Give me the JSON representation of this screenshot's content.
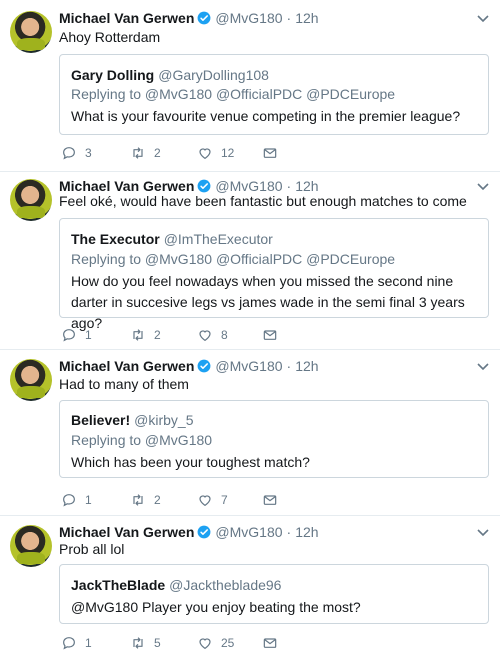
{
  "tweets": [
    {
      "author": "Michael Van Gerwen",
      "handle": "@MvG180",
      "dot": "·",
      "time": "12h",
      "text": "Ahoy Rotterdam",
      "quote": {
        "name": "Gary Dolling",
        "handle": "@GaryDolling108",
        "replying": "Replying to @MvG180 @OfficialPDC @PDCEurope",
        "text": "What is your favourite venue competing in the premier league?"
      },
      "replies": "3",
      "retweets": "2",
      "likes": "12"
    },
    {
      "author": "Michael Van Gerwen",
      "handle": "@MvG180",
      "dot": "·",
      "time": "12h",
      "text": "Feel oké, would have been fantastic but enough matches to come",
      "quote": {
        "name": "The Executor",
        "handle": "@ImTheExecutor",
        "replying": "Replying to @MvG180 @OfficialPDC @PDCEurope",
        "text": "How do you feel nowadays when you missed the second nine darter in succesive legs vs james wade in the semi final 3 years ago?"
      },
      "replies": "1",
      "retweets": "2",
      "likes": "8"
    },
    {
      "author": "Michael Van Gerwen",
      "handle": "@MvG180",
      "dot": "·",
      "time": "12h",
      "text": "Had to many of them",
      "quote": {
        "name": "Believer!",
        "handle": "@kirby_5",
        "replying": "Replying to @MvG180",
        "text": "Which has been your toughest match?"
      },
      "replies": "1",
      "retweets": "2",
      "likes": "7"
    },
    {
      "author": "Michael Van Gerwen",
      "handle": "@MvG180",
      "dot": "·",
      "time": "12h",
      "text": "Prob all lol",
      "quote": {
        "name": "JackTheBlade",
        "handle": "@Jacktheblade96",
        "replying": "",
        "text": "@MvG180 Player you enjoy beating the most?"
      },
      "replies": "1",
      "retweets": "5",
      "likes": "25"
    }
  ],
  "colors": {
    "text": "#14171a",
    "secondary": "#657786",
    "border": "#e6ecf0",
    "quote_border": "#ccd6dd",
    "verified": "#1da1f2"
  },
  "icons": [
    "verified-badge-icon",
    "chevron-down-icon",
    "reply-icon",
    "retweet-icon",
    "like-icon",
    "direct-message-icon"
  ]
}
